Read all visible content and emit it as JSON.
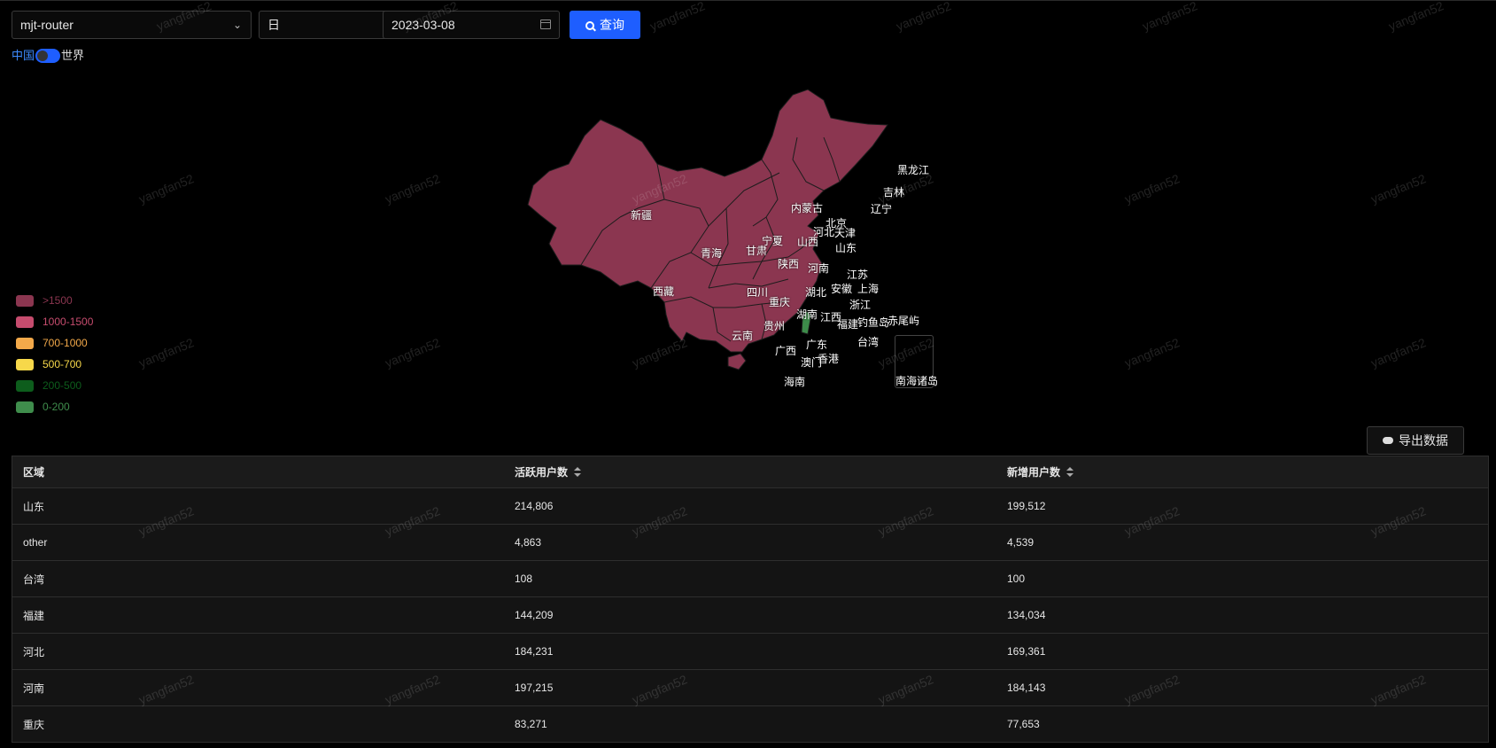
{
  "toolbar": {
    "app_select_value": "mjt-router",
    "period_select_value": "日",
    "date_value": "2023-03-08",
    "query_label": "查询"
  },
  "scope_toggle": {
    "left_label": "中国",
    "right_label": "世界"
  },
  "map": {
    "labels": {
      "heilongjiang": "黑龙江",
      "jilin": "吉林",
      "liaoning": "辽宁",
      "neimenggu": "内蒙古",
      "xinjiang": "新疆",
      "beijing": "北京",
      "tianjin": "天津",
      "hebei": "河北",
      "ningxia": "宁夏",
      "shanxi": "山西",
      "shandong": "山东",
      "qinghai": "青海",
      "gansu": "甘肃",
      "shaanxi": "陕西",
      "henan": "河南",
      "jiangsu": "江苏",
      "xizang": "西藏",
      "sichuan": "四川",
      "hubei": "湖北",
      "anhui": "安徽",
      "shanghai": "上海",
      "chongqing": "重庆",
      "zhejiang": "浙江",
      "hunan": "湖南",
      "jiangxi": "江西",
      "guizhou": "贵州",
      "fujian": "福建",
      "diaoyudao": "钓鱼岛",
      "chiweiyu": "赤尾屿",
      "yunnan": "云南",
      "guangdong": "广东",
      "taiwan": "台湾",
      "guangxi": "广西",
      "xianggang": "香港",
      "aomen": "澳门",
      "hainan": "海南",
      "nanhai": "南海诸岛"
    },
    "colors": {
      "high": "#8b3650",
      "low": "#3d8c4a",
      "border": "#1c1c1c"
    }
  },
  "legend": [
    {
      "label": ">1500",
      "color": "#8b3650"
    },
    {
      "label": "1000-1500",
      "color": "#c64c6e"
    },
    {
      "label": "700-1000",
      "color": "#f3a94a"
    },
    {
      "label": "500-700",
      "color": "#f7d84a"
    },
    {
      "label": "200-500",
      "color": "#0d5d1c"
    },
    {
      "label": "0-200",
      "color": "#3f8d4c"
    }
  ],
  "export_label": "导出数据",
  "table": {
    "headers": [
      "区域",
      "活跃用户数",
      "新增用户数"
    ],
    "rows": [
      [
        "山东",
        "214,806",
        "199,512"
      ],
      [
        "other",
        "4,863",
        "4,539"
      ],
      [
        "台湾",
        "108",
        "100"
      ],
      [
        "福建",
        "144,209",
        "134,034"
      ],
      [
        "河北",
        "184,231",
        "169,361"
      ],
      [
        "河南",
        "197,215",
        "184,143"
      ],
      [
        "重庆",
        "83,271",
        "77,653"
      ]
    ]
  },
  "watermark": "yangfan52"
}
